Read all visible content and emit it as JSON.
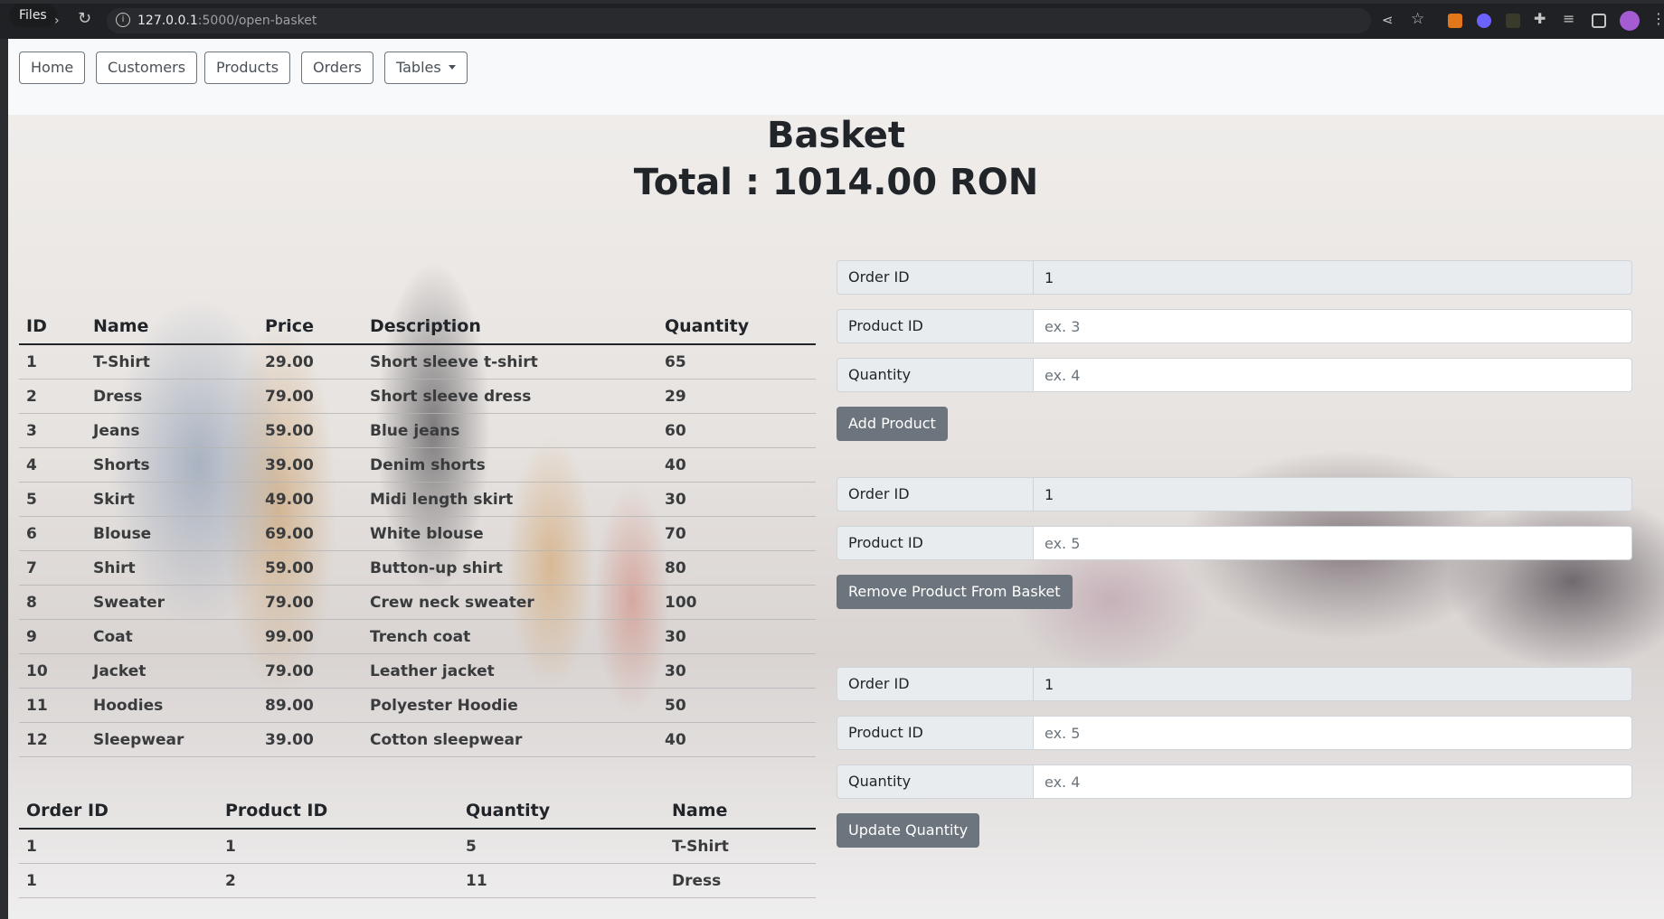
{
  "browser": {
    "files_label": "Files",
    "url_host": "127.0.0.1",
    "url_path": ":5000/open-basket"
  },
  "nav": {
    "home": "Home",
    "customers": "Customers",
    "products": "Products",
    "orders": "Orders",
    "tables": "Tables"
  },
  "page": {
    "title": "Basket",
    "total": "Total : 1014.00 RON"
  },
  "products_table": {
    "headers": [
      "ID",
      "Name",
      "Price",
      "Description",
      "Quantity"
    ],
    "rows": [
      [
        "1",
        "T-Shirt",
        "29.00",
        "Short sleeve t-shirt",
        "65"
      ],
      [
        "2",
        "Dress",
        "79.00",
        "Short sleeve dress",
        "29"
      ],
      [
        "3",
        "Jeans",
        "59.00",
        "Blue jeans",
        "60"
      ],
      [
        "4",
        "Shorts",
        "39.00",
        "Denim shorts",
        "40"
      ],
      [
        "5",
        "Skirt",
        "49.00",
        "Midi length skirt",
        "30"
      ],
      [
        "6",
        "Blouse",
        "69.00",
        "White blouse",
        "70"
      ],
      [
        "7",
        "Shirt",
        "59.00",
        "Button-up shirt",
        "80"
      ],
      [
        "8",
        "Sweater",
        "79.00",
        "Crew neck sweater",
        "100"
      ],
      [
        "9",
        "Coat",
        "99.00",
        "Trench coat",
        "30"
      ],
      [
        "10",
        "Jacket",
        "79.00",
        "Leather jacket",
        "30"
      ],
      [
        "11",
        "Hoodies",
        "89.00",
        "Polyester Hoodie",
        "50"
      ],
      [
        "12",
        "Sleepwear",
        "39.00",
        "Cotton sleepwear",
        "40"
      ]
    ]
  },
  "basket_table": {
    "headers": [
      "Order ID",
      "Product ID",
      "Quantity",
      "Name"
    ],
    "rows": [
      [
        "1",
        "1",
        "5",
        "T-Shirt"
      ],
      [
        "1",
        "2",
        "11",
        "Dress"
      ]
    ]
  },
  "add_form": {
    "order_label": "Order ID",
    "order_value": "1",
    "product_label": "Product ID",
    "product_placeholder": "ex. 3",
    "quantity_label": "Quantity",
    "quantity_placeholder": "ex. 4",
    "button": "Add Product"
  },
  "remove_form": {
    "order_label": "Order ID",
    "order_value": "1",
    "product_label": "Product ID",
    "product_placeholder": "ex. 5",
    "button": "Remove Product From Basket"
  },
  "update_form": {
    "order_label": "Order ID",
    "order_value": "1",
    "product_label": "Product ID",
    "product_placeholder": "ex. 5",
    "quantity_label": "Quantity",
    "quantity_placeholder": "ex. 4",
    "button": "Update Quantity"
  },
  "icons": [
    "back-icon",
    "reload-icon",
    "site-info-icon",
    "share-icon",
    "bookmark-star-icon",
    "metamask-extension-icon",
    "extension-icon",
    "extensions-puzzle-icon",
    "reading-list-icon",
    "side-panel-icon",
    "profile-avatar-icon",
    "menu-icon"
  ]
}
